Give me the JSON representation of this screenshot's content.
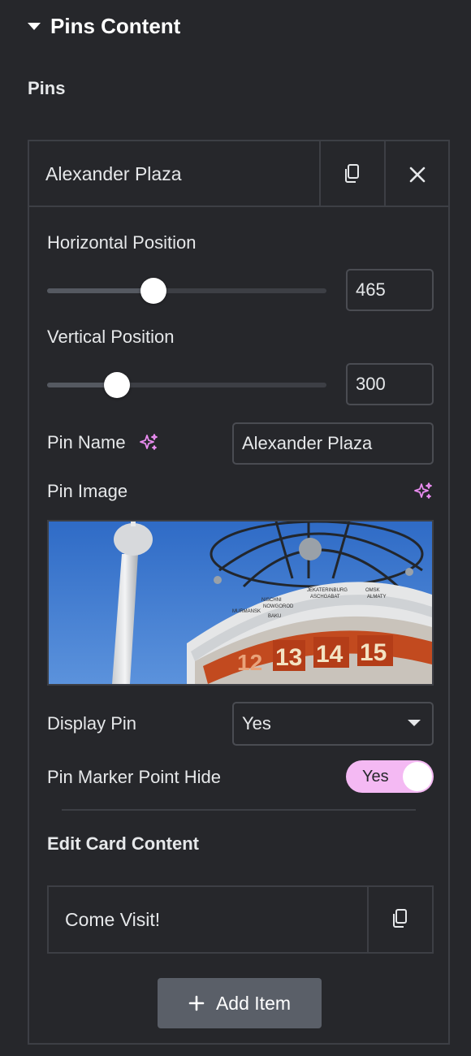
{
  "section": {
    "title": "Pins Content"
  },
  "pins_label": "Pins",
  "pin_item": {
    "title": "Alexander Plaza",
    "duplicate_icon": "duplicate-icon",
    "remove_icon": "close-icon"
  },
  "horizontal": {
    "label": "Horizontal Position",
    "value": "465",
    "fraction": 0.38
  },
  "vertical": {
    "label": "Vertical Position",
    "value": "300",
    "fraction": 0.25
  },
  "pin_name": {
    "label": "Pin Name",
    "value": "Alexander Plaza",
    "ai_icon": "sparkle-icon"
  },
  "pin_image": {
    "label": "Pin Image",
    "ai_icon": "sparkle-icon"
  },
  "display_pin": {
    "label": "Display Pin",
    "value": "Yes"
  },
  "marker_hide": {
    "label": "Pin Marker Point Hide",
    "value": "Yes",
    "on": true
  },
  "card": {
    "heading": "Edit Card Content",
    "item_title": "Come Visit!",
    "add_label": "Add Item"
  },
  "colors": {
    "background": "#26272b",
    "border": "#3d3f45",
    "toggle_on": "#f4b9f3",
    "sparkle": "#e98cf0",
    "add_button": "#5a5f68"
  }
}
